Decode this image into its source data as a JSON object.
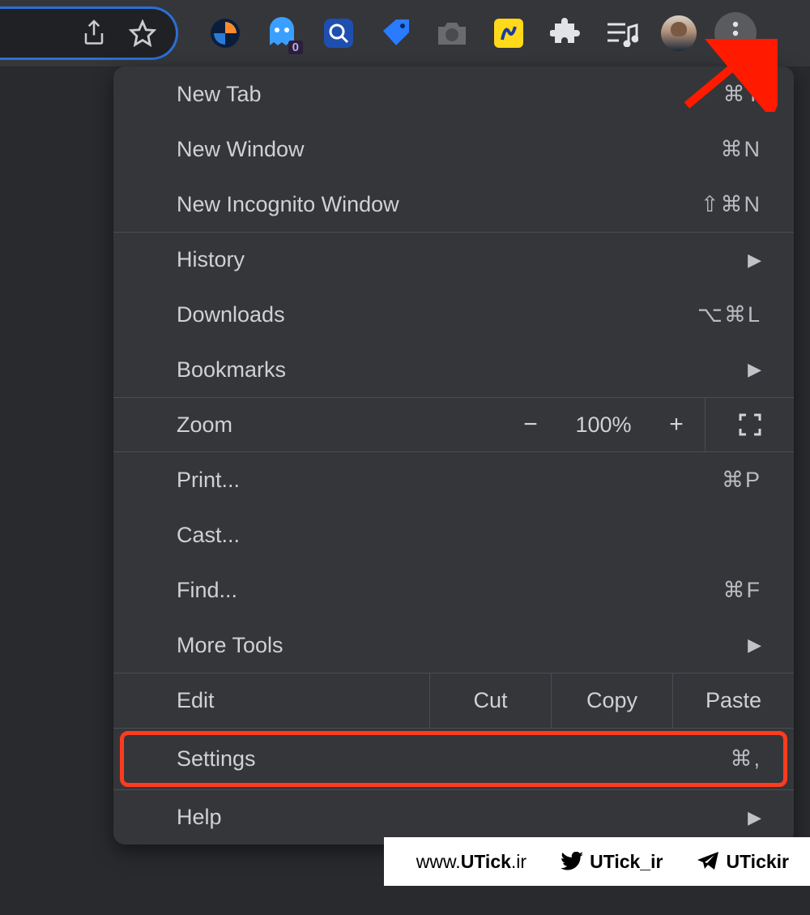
{
  "toolbar": {
    "extension_badge": "0"
  },
  "menu": {
    "new_tab": {
      "label": "New Tab",
      "shortcut": "⌘T"
    },
    "new_window": {
      "label": "New Window",
      "shortcut": "⌘N"
    },
    "new_incognito": {
      "label": "New Incognito Window",
      "shortcut": "⇧⌘N"
    },
    "history": {
      "label": "History"
    },
    "downloads": {
      "label": "Downloads",
      "shortcut": "⌥⌘L"
    },
    "bookmarks": {
      "label": "Bookmarks"
    },
    "zoom": {
      "label": "Zoom",
      "minus": "−",
      "value": "100%",
      "plus": "+"
    },
    "print": {
      "label": "Print...",
      "shortcut": "⌘P"
    },
    "cast": {
      "label": "Cast..."
    },
    "find": {
      "label": "Find...",
      "shortcut": "⌘F"
    },
    "more_tools": {
      "label": "More Tools"
    },
    "edit": {
      "label": "Edit",
      "cut": "Cut",
      "copy": "Copy",
      "paste": "Paste"
    },
    "settings": {
      "label": "Settings",
      "shortcut": "⌘,"
    },
    "help": {
      "label": "Help"
    }
  },
  "watermark": {
    "site_prefix": "www.",
    "site_main": "UTick",
    "site_suffix": ".ir",
    "twitter": "UTick_ir",
    "telegram": "UTickir"
  }
}
